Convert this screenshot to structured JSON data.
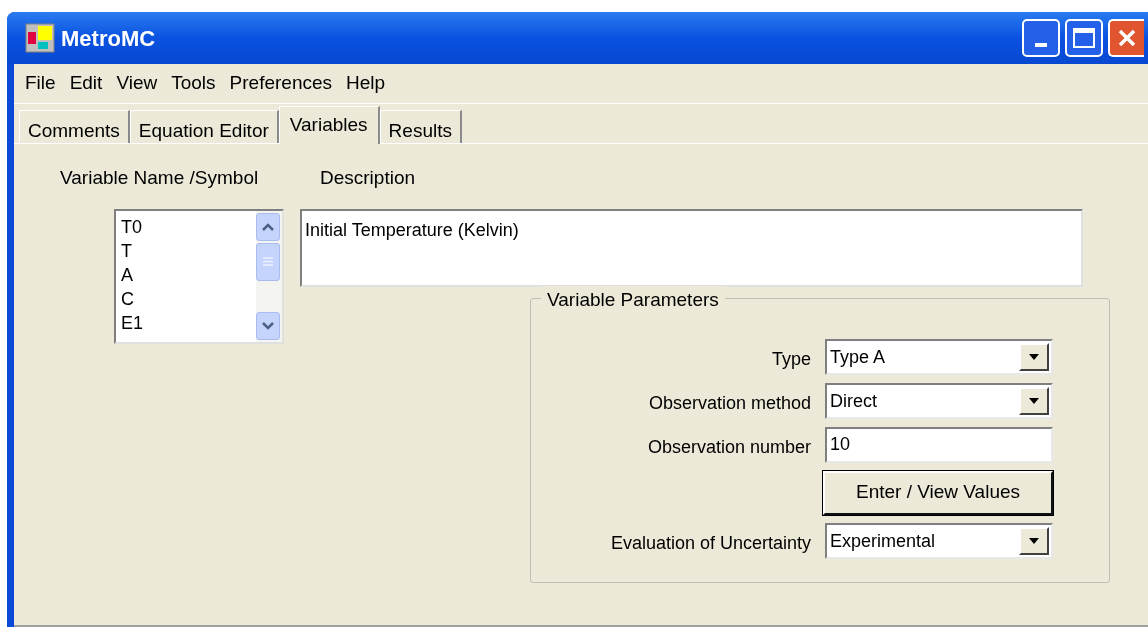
{
  "window": {
    "title": "MetroMC"
  },
  "menu": [
    "File",
    "Edit",
    "View",
    "Tools",
    "Preferences",
    "Help"
  ],
  "tabs": [
    {
      "label": "Comments",
      "selected": false
    },
    {
      "label": "Equation Editor",
      "selected": false
    },
    {
      "label": "Variables",
      "selected": true
    },
    {
      "label": "Results",
      "selected": false
    }
  ],
  "variables": {
    "heading": "Variable Name /Symbol",
    "items": [
      "T0",
      "T",
      "A",
      "C",
      "E1"
    ]
  },
  "description": {
    "heading": "Description",
    "value": "Initial Temperature (Kelvin)"
  },
  "parameters": {
    "title": "Variable Parameters",
    "rows": [
      {
        "kind": "select",
        "label": "Type",
        "value": "Type A"
      },
      {
        "kind": "select",
        "label": "Observation method",
        "value": "Direct"
      },
      {
        "kind": "text",
        "label": "Observation number",
        "value": "10"
      },
      {
        "kind": "button",
        "label": "Enter / View Values"
      },
      {
        "kind": "select",
        "label": "Evaluation of Uncertainty",
        "value": "Experimental"
      }
    ]
  }
}
